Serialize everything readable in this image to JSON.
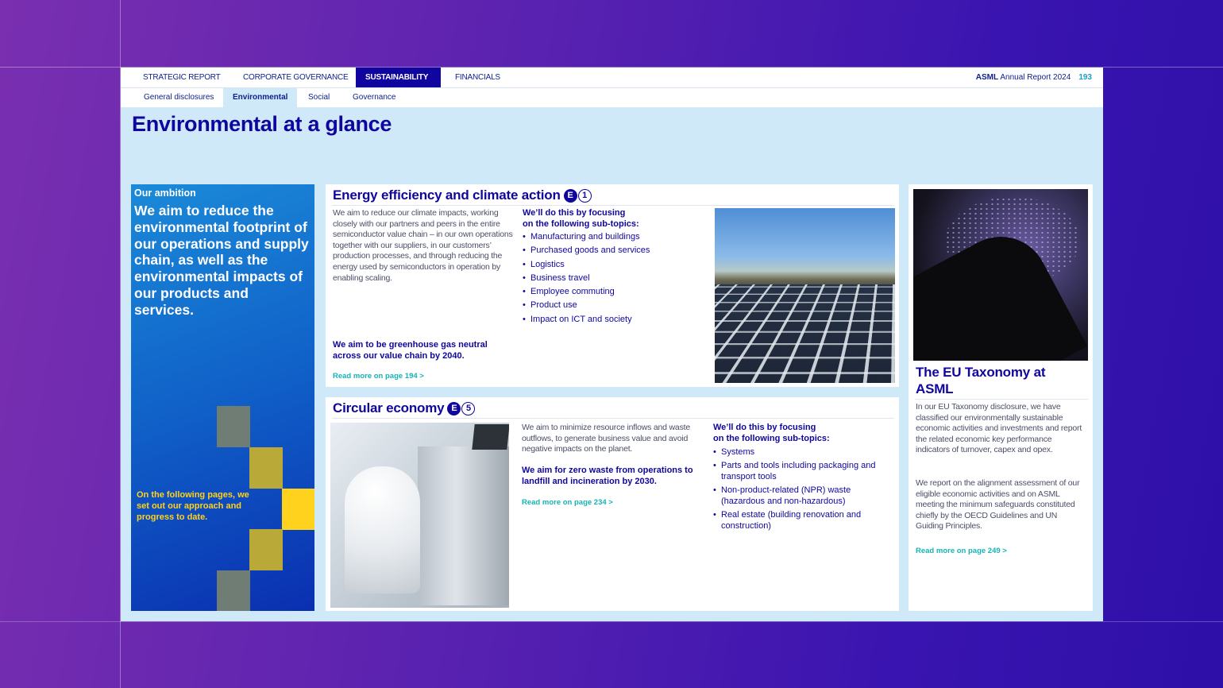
{
  "nav": {
    "tabs": [
      {
        "label": "STRATEGIC REPORT"
      },
      {
        "label": "CORPORATE GOVERNANCE"
      },
      {
        "label": "SUSTAINABILITY"
      },
      {
        "label": "FINANCIALS"
      }
    ],
    "brand_bold": "ASML",
    "brand_text": " Annual Report 2024",
    "page_number": "193",
    "subtabs": [
      {
        "label": "General disclosures"
      },
      {
        "label": "Environmental"
      },
      {
        "label": "Social"
      },
      {
        "label": "Governance"
      }
    ]
  },
  "page_title": "Environmental at a glance",
  "ambition": {
    "label": "Our ambition",
    "statement": "We aim to reduce the environmental footprint of our operations and supply chain, as well as the environmental impacts of our products and services.",
    "note": "On the following pages, we set out our approach and progress to date."
  },
  "energy": {
    "heading": "Energy efficiency and climate action",
    "badge_letter": "E",
    "badge_number": "1",
    "body": "We aim to reduce our climate impacts, working closely with our partners and peers in the entire semiconductor value chain – in our own operations together with our suppliers, in our customers’ production processes, and through reducing the energy used by semiconductors in operation by enabling scaling.",
    "focus_heading_1": "We’ll do this by focusing",
    "focus_heading_2": "on the following sub-topics:",
    "subtopics": [
      "Manufacturing and buildings",
      "Purchased goods and services",
      "Logistics",
      "Business travel",
      "Employee commuting",
      "Product use",
      "Impact on ICT and society"
    ],
    "target": "We aim to be greenhouse gas neutral across our value chain by 2040.",
    "link": "Read more on page 194 >"
  },
  "circular": {
    "heading": "Circular economy",
    "badge_letter": "E",
    "badge_number": "5",
    "body": "We aim to minimize resource inflows and waste outflows, to generate business value and avoid negative impacts on the planet.",
    "target": "We aim for zero waste from operations to landfill and incineration by 2030.",
    "link": "Read more on page 234 >",
    "focus_heading_1": "We’ll do this by focusing",
    "focus_heading_2": "on the following sub-topics:",
    "subtopics": [
      "Systems",
      "Parts and tools including packaging and transport tools",
      "Non-product-related (NPR) waste (hazardous and non-hazardous)",
      "Real estate (building renovation and construction)"
    ]
  },
  "taxonomy": {
    "heading": "The EU Taxonomy at ASML",
    "para1": "In our EU Taxonomy disclosure, we have classified our environmentally sustainable economic activities and investments and report the related economic key performance indicators of turnover, capex and opex.",
    "para2": "We report on the alignment assessment of our eligible economic activities and on ASML meeting the minimum safeguards constituted chiefly by the OECD Guidelines and UN Guiding Principles.",
    "link": "Read more on page 249 >"
  },
  "colors": {
    "brand_blue": "#10069f",
    "link_teal": "#16b4b4",
    "ambition_yellow": "#ffd21e"
  }
}
